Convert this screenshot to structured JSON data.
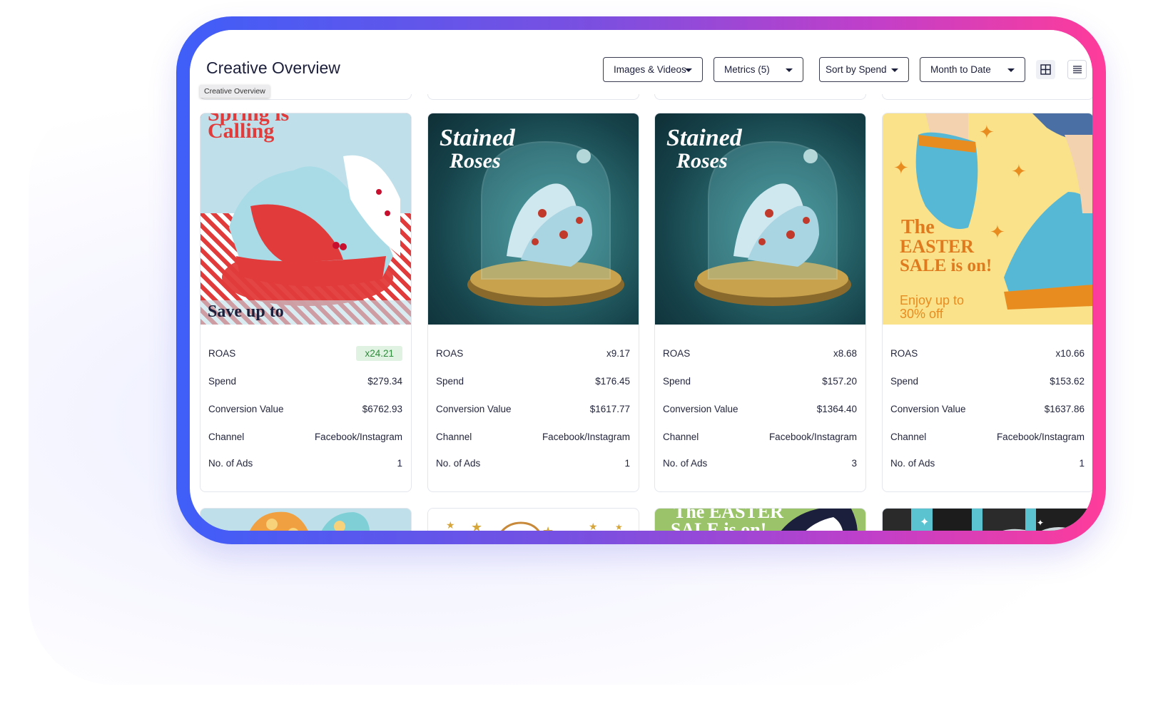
{
  "header": {
    "title": "Creative Overview",
    "tooltip": "Creative Overview",
    "filters": [
      {
        "label": "Images & Videos"
      },
      {
        "label": "Metrics (5)"
      },
      {
        "label": "Sort by Spend"
      },
      {
        "label": "Month to Date"
      }
    ]
  },
  "metric_labels": {
    "roas": "ROAS",
    "spend": "Spend",
    "conversion_value": "Conversion Value",
    "channel": "Channel",
    "ads": "No. of Ads"
  },
  "cards": [
    {
      "image_text_1": "Spring is",
      "image_text_2": "Calling",
      "image_text_3": "Save up to",
      "roas": "x24.21",
      "spend": "$279.34",
      "conversion_value": "$6762.93",
      "channel": "Facebook/Instagram",
      "ads": "1"
    },
    {
      "image_text_1": "Stained",
      "image_text_2": "Roses",
      "roas": "x9.17",
      "spend": "$176.45",
      "conversion_value": "$1617.77",
      "channel": "Facebook/Instagram",
      "ads": "1"
    },
    {
      "image_text_1": "Stained",
      "image_text_2": "Roses",
      "roas": "x8.68",
      "spend": "$157.20",
      "conversion_value": "$1364.40",
      "channel": "Facebook/Instagram",
      "ads": "3"
    },
    {
      "image_text_1": "The",
      "image_text_2": "EASTER",
      "image_text_3": "SALE is on!",
      "image_text_4": "Enjoy up to",
      "image_text_5": "30% off",
      "roas": "x10.66",
      "spend": "$153.62",
      "conversion_value": "$1637.86",
      "channel": "Facebook/Instagram",
      "ads": "1"
    }
  ],
  "bottom_cards": [
    {
      "image_text_1": "The EASTER",
      "image_text_2": "SALE is on!"
    }
  ],
  "brand": {
    "highlight_green": "#2d8a3a",
    "gradient_start": "#3f5ef8",
    "gradient_end": "#ff3c9a"
  }
}
